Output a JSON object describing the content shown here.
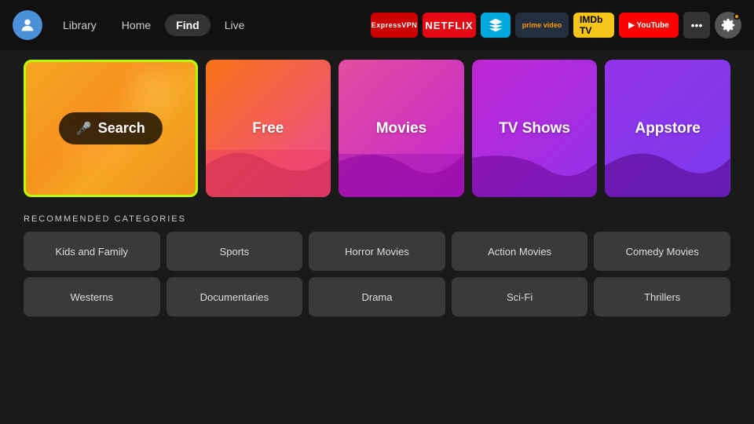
{
  "nav": {
    "links": [
      {
        "label": "Library",
        "active": false
      },
      {
        "label": "Home",
        "active": false
      },
      {
        "label": "Find",
        "active": true
      },
      {
        "label": "Live",
        "active": false
      }
    ],
    "apps": [
      {
        "label": "ExpressVPN",
        "class": "badge-express"
      },
      {
        "label": "NETFLIX",
        "class": "badge-netflix"
      },
      {
        "label": "↩",
        "class": "badge-prime"
      },
      {
        "label": "prime video",
        "class": "badge-amazon"
      },
      {
        "label": "IMDb TV",
        "class": "badge-imdb"
      },
      {
        "label": "▶ YouTube",
        "class": "badge-youtube"
      }
    ],
    "more_label": "•••",
    "settings_label": "⚙"
  },
  "tiles": [
    {
      "id": "search",
      "label": "Search",
      "type": "search"
    },
    {
      "id": "free",
      "label": "Free",
      "type": "free"
    },
    {
      "id": "movies",
      "label": "Movies",
      "type": "movies"
    },
    {
      "id": "tvshows",
      "label": "TV Shows",
      "type": "tvshows"
    },
    {
      "id": "appstore",
      "label": "Appstore",
      "type": "appstore"
    }
  ],
  "recommended": {
    "title": "RECOMMENDED CATEGORIES",
    "categories_row1": [
      "Kids and Family",
      "Sports",
      "Horror Movies",
      "Action Movies",
      "Comedy Movies"
    ],
    "categories_row2": [
      "Westerns",
      "Documentaries",
      "Drama",
      "Sci-Fi",
      "Thrillers"
    ]
  }
}
